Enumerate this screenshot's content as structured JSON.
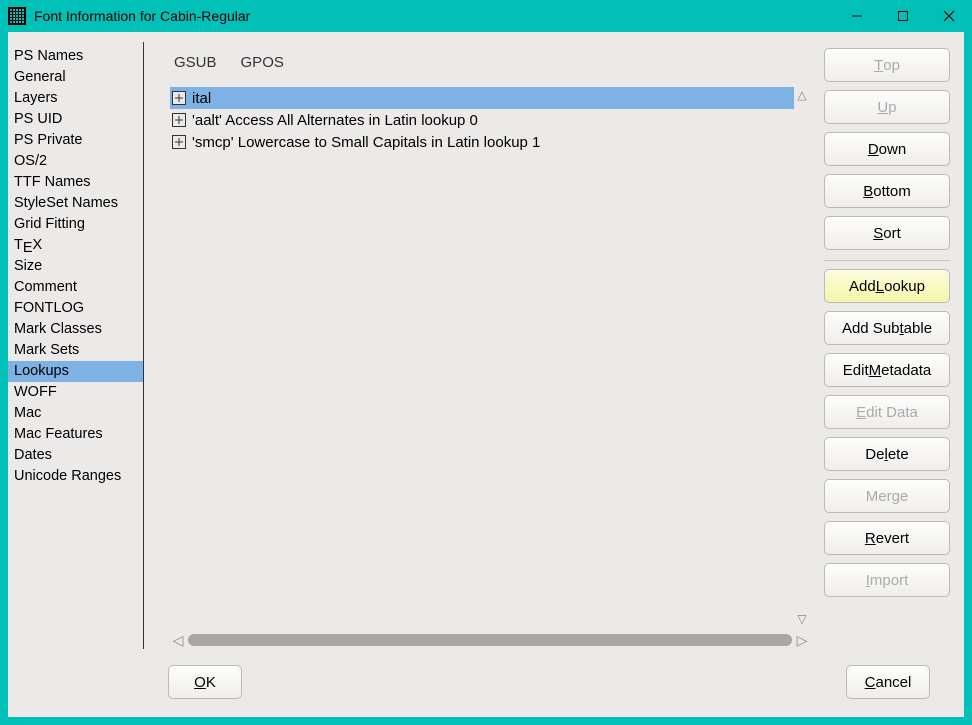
{
  "window": {
    "title": "Font Information for Cabin-Regular"
  },
  "sidebar": {
    "items": [
      "PS Names",
      "General",
      "Layers",
      "PS UID",
      "PS Private",
      "OS/2",
      "TTF Names",
      "StyleSet Names",
      "Grid Fitting",
      "TeX",
      "Size",
      "Comment",
      "FONTLOG",
      "Mark Classes",
      "Mark Sets",
      "Lookups",
      "WOFF",
      "Mac",
      "Mac Features",
      "Dates",
      "Unicode Ranges"
    ],
    "selected_index": 15
  },
  "tabs": {
    "gsub": "GSUB",
    "gpos": "GPOS",
    "active_index": 0
  },
  "lookups": [
    {
      "label": "ital",
      "selected": true
    },
    {
      "label": "'aalt' Access All Alternates in Latin lookup 0",
      "selected": false
    },
    {
      "label": "'smcp' Lowercase to Small Capitals in Latin lookup 1",
      "selected": false
    }
  ],
  "buttons": {
    "top": {
      "pre": "",
      "ul": "T",
      "post": "op",
      "disabled": true
    },
    "up": {
      "pre": "",
      "ul": "U",
      "post": "p",
      "disabled": true
    },
    "down": {
      "pre": "",
      "ul": "D",
      "post": "own",
      "disabled": false
    },
    "bottom": {
      "pre": "",
      "ul": "B",
      "post": "ottom",
      "disabled": false
    },
    "sort": {
      "pre": "",
      "ul": "S",
      "post": "ort",
      "disabled": false
    },
    "add_lookup": {
      "pre": "Add ",
      "ul": "L",
      "post": "ookup",
      "disabled": false,
      "yellow": true
    },
    "add_subtable": {
      "pre": "Add Sub",
      "ul": "t",
      "post": "able",
      "disabled": false
    },
    "edit_metadata": {
      "pre": "Edit ",
      "ul": "M",
      "post": "etadata",
      "disabled": false
    },
    "edit_data": {
      "pre": "",
      "ul": "E",
      "post": "dit Data",
      "disabled": true
    },
    "delete": {
      "pre": "De",
      "ul": "l",
      "post": "ete",
      "disabled": false
    },
    "merge": {
      "pre": "Mer",
      "ul": "g",
      "post": "e",
      "disabled": true
    },
    "revert": {
      "pre": "",
      "ul": "R",
      "post": "evert",
      "disabled": false
    },
    "import": {
      "pre": "",
      "ul": "I",
      "post": "mport",
      "disabled": true
    }
  },
  "footer": {
    "ok": {
      "pre": "",
      "ul": "O",
      "post": "K"
    },
    "cancel": {
      "pre": "",
      "ul": "C",
      "post": "ancel"
    }
  }
}
